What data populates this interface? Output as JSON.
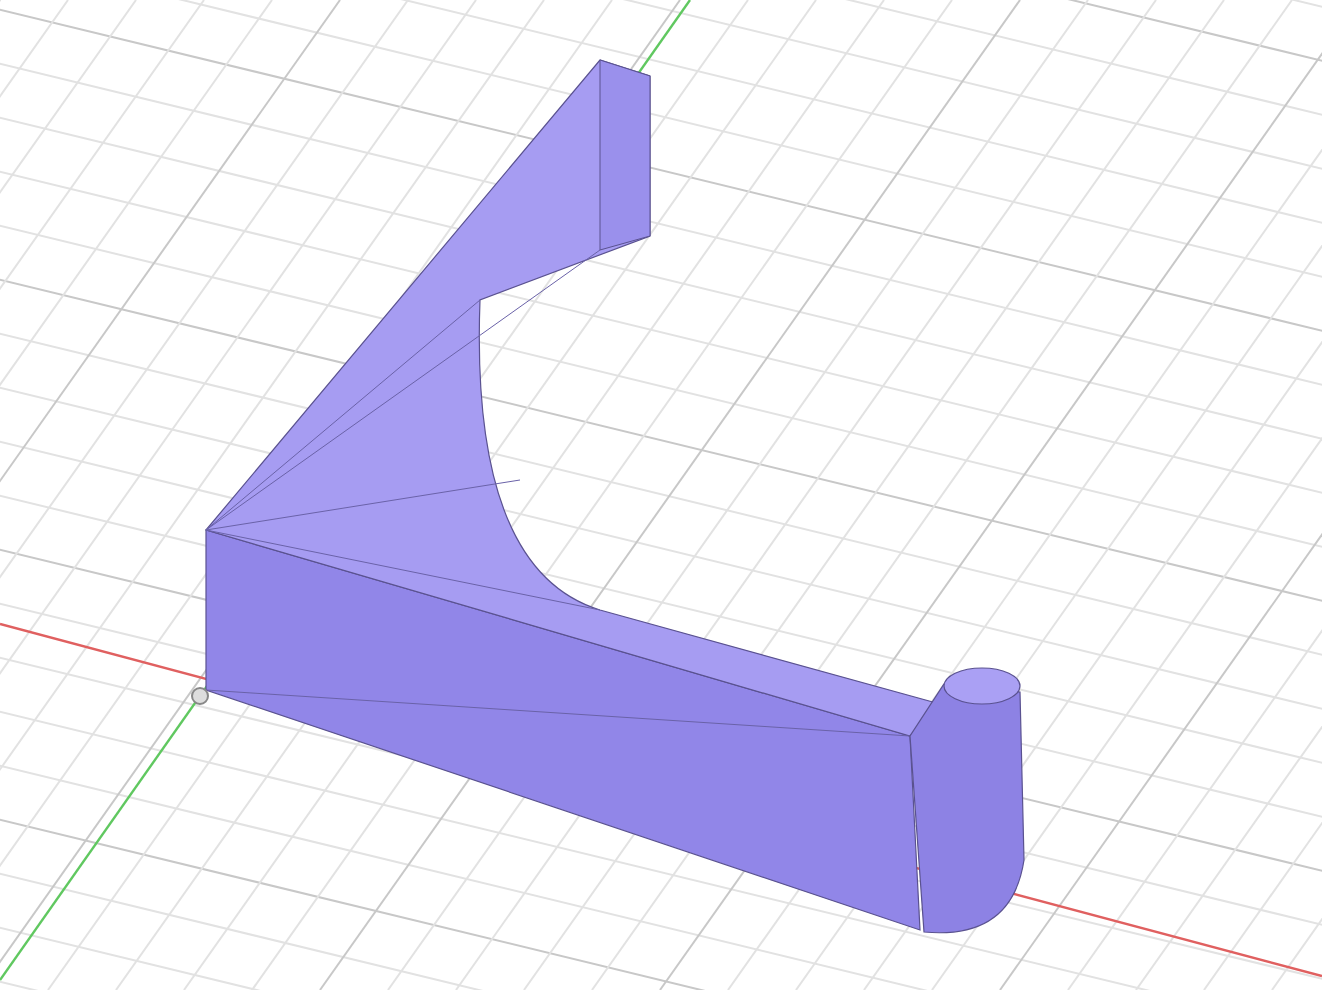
{
  "viewport": {
    "kind": "perspective",
    "model": {
      "kind": "bracket"
    }
  }
}
